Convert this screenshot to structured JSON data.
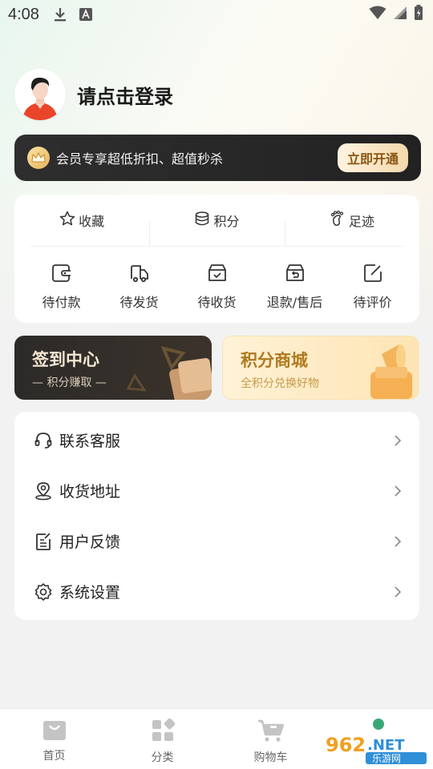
{
  "status_bar": {
    "time": "4:08"
  },
  "profile": {
    "login_text": "请点击登录"
  },
  "vip": {
    "text": "会员专享超低折扣、超值秒杀",
    "button": "立即开通"
  },
  "quick_links": [
    {
      "label": "收藏",
      "icon": "star-icon"
    },
    {
      "label": "积分",
      "icon": "coins-icon"
    },
    {
      "label": "足迹",
      "icon": "footprint-icon"
    }
  ],
  "orders": [
    {
      "label": "待付款",
      "icon": "wallet-icon"
    },
    {
      "label": "待发货",
      "icon": "truck-icon"
    },
    {
      "label": "待收货",
      "icon": "inbox-icon"
    },
    {
      "label": "退款/售后",
      "icon": "refund-icon"
    },
    {
      "label": "待评价",
      "icon": "review-icon"
    }
  ],
  "promos": {
    "sign": {
      "title": "签到中心",
      "subtitle": "— 积分赚取 —"
    },
    "mall": {
      "title": "积分商城",
      "subtitle": "全积分兑换好物"
    }
  },
  "menu": [
    {
      "label": "联系客服",
      "icon": "headset-icon"
    },
    {
      "label": "收货地址",
      "icon": "location-icon"
    },
    {
      "label": "用户反馈",
      "icon": "feedback-icon"
    },
    {
      "label": "系统设置",
      "icon": "settings-icon"
    }
  ],
  "tabbar": [
    {
      "label": "首页",
      "icon": "home-bag-icon"
    },
    {
      "label": "分类",
      "icon": "category-icon"
    },
    {
      "label": "购物车",
      "icon": "cart-icon"
    }
  ],
  "watermark": {
    "text": "962.NET 乐游网"
  },
  "colors": {
    "accent": "#b0791f",
    "vip_bg": "#262626",
    "green_dot": "#3aa876"
  }
}
